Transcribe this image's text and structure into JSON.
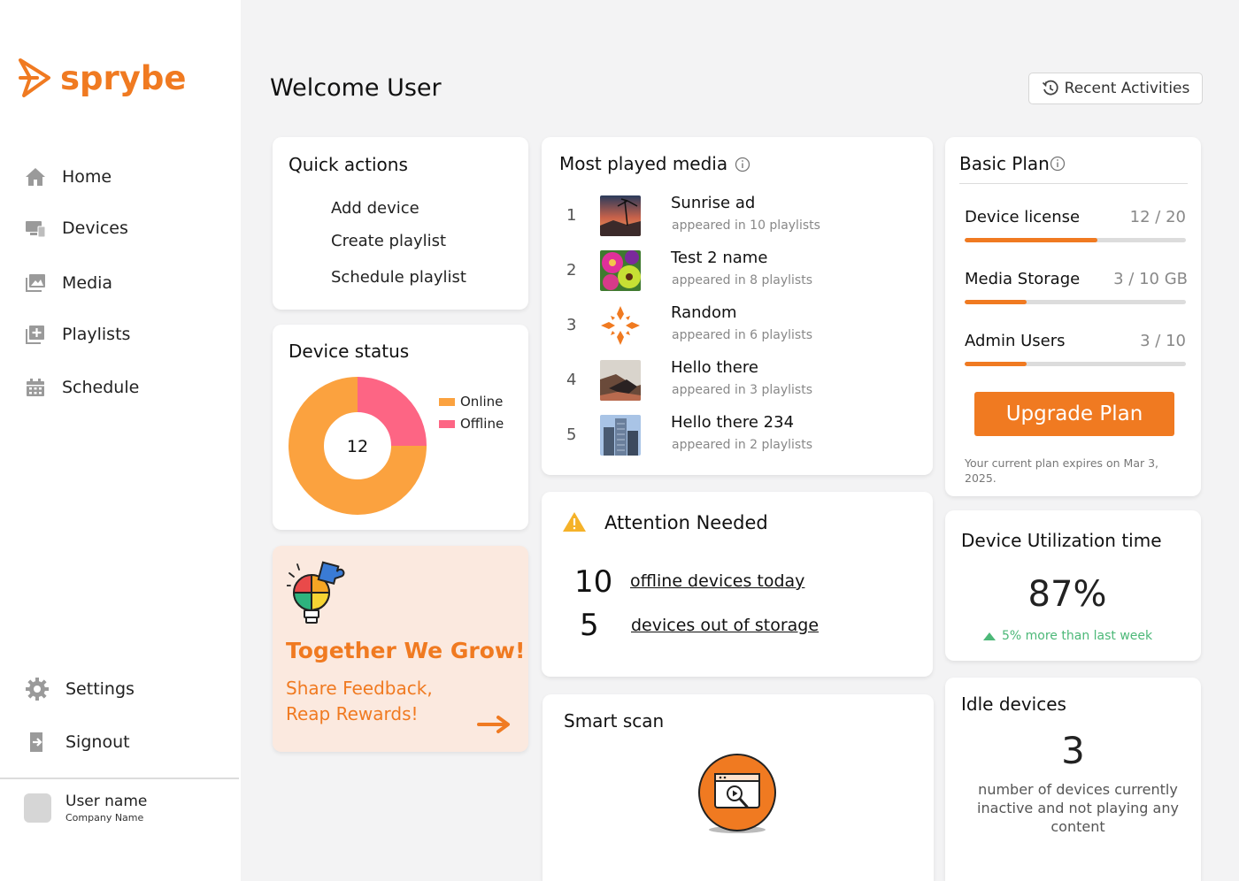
{
  "brand": {
    "name": "sprybe",
    "color": "#f07a21"
  },
  "sidebar": {
    "items": [
      {
        "label": "Home",
        "icon": "home-icon"
      },
      {
        "label": "Devices",
        "icon": "devices-icon"
      },
      {
        "label": "Media",
        "icon": "media-icon"
      },
      {
        "label": "Playlists",
        "icon": "playlists-icon"
      },
      {
        "label": "Schedule",
        "icon": "calendar-icon"
      }
    ],
    "bottom_items": [
      {
        "label": "Settings",
        "icon": "gear-icon"
      },
      {
        "label": "Signout",
        "icon": "signout-icon"
      }
    ],
    "user": {
      "name": "User name",
      "company": "Company Name"
    }
  },
  "header": {
    "welcome": "Welcome User",
    "recent_activities": "Recent Activities"
  },
  "quick_actions": {
    "title": "Quick actions",
    "items": [
      "Add device",
      "Create playlist",
      "Schedule playlist"
    ]
  },
  "device_status": {
    "title": "Device status",
    "total": "12",
    "legend": [
      {
        "label": "Online",
        "color": "#fba23f"
      },
      {
        "label": "Offline",
        "color": "#fd6584"
      }
    ],
    "chart_data": {
      "type": "pie",
      "categories": [
        "Online",
        "Offline"
      ],
      "values": [
        9,
        3
      ],
      "center_label": "12"
    }
  },
  "promo": {
    "title": "Together We Grow!",
    "line1": "Share Feedback,",
    "line2": "Reap Rewards!",
    "bg_color": "#fbe9df"
  },
  "most_played": {
    "title": "Most played media",
    "items": [
      {
        "rank": "1",
        "name": "Sunrise ad",
        "sub": "appeared in 10 playlists"
      },
      {
        "rank": "2",
        "name": "Test 2 name",
        "sub": "appeared in 8 playlists"
      },
      {
        "rank": "3",
        "name": "Random",
        "sub": "appeared in 6 playlists"
      },
      {
        "rank": "4",
        "name": "Hello there",
        "sub": "appeared in 3 playlists"
      },
      {
        "rank": "5",
        "name": "Hello there 234",
        "sub": "appeared in 2 playlists"
      }
    ]
  },
  "attention": {
    "title": "Attention Needed",
    "items": [
      {
        "count": "10",
        "label": "offline devices today"
      },
      {
        "count": "5",
        "label": "devices out of storage"
      }
    ]
  },
  "smart_scan": {
    "title": "Smart scan"
  },
  "plan": {
    "title": "Basic Plan",
    "rows": [
      {
        "label": "Device license",
        "value": "12 / 20",
        "fraction": 0.6
      },
      {
        "label": "Media Storage",
        "value": "3 / 10 GB",
        "fraction": 0.28
      },
      {
        "label": "Admin Users",
        "value": "3 / 10",
        "fraction": 0.28
      }
    ],
    "upgrade": "Upgrade Plan",
    "expiry": "Your current plan expires on Mar 3, 2025."
  },
  "utilization": {
    "title": "Device Utilization time",
    "value": "87%",
    "delta": "5% more than last week",
    "delta_color": "#4cb878"
  },
  "idle": {
    "title": "Idle devices",
    "value": "3",
    "description": "number of devices currently inactive and not playing any content"
  }
}
